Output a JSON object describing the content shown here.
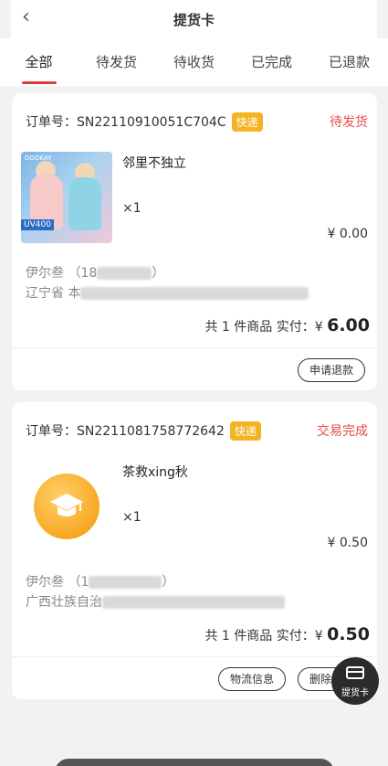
{
  "header": {
    "title": "提货卡",
    "back_icon": "‹"
  },
  "tabs": [
    {
      "label": "全部",
      "active": true
    },
    {
      "label": "待发货"
    },
    {
      "label": "待收货"
    },
    {
      "label": "已完成"
    },
    {
      "label": "已退款"
    }
  ],
  "orders": [
    {
      "order_no": "订单号：SN22110910051C704C",
      "badge": "快递",
      "status": "待发货",
      "product_name": "邻里不独立",
      "quantity": "×1",
      "price": "¥ 0.00",
      "recipient_name": "伊尔叁",
      "recipient_phone": "（18",
      "recipient_phone_end": "）",
      "address_start": "辽宁省 本",
      "total_prefix": "共 1 件商品 实付：¥",
      "total_amount": "6.00",
      "buttons": [
        "申请退款"
      ],
      "thumb_brand": "DOOKAY",
      "thumb_uv": "UV400"
    },
    {
      "order_no": "订单号：SN2211081758772642",
      "badge": "快递",
      "status": "交易完成",
      "product_name": "茶救xing秋",
      "quantity": "×1",
      "price": "¥ 0.50",
      "recipient_name": "伊尔叁",
      "recipient_phone": "（1",
      "recipient_phone_end": "）",
      "address_start": "广西壮族自治",
      "total_prefix": "共 1 件商品 实付：¥",
      "total_amount": "0.50",
      "buttons": [
        "物流信息",
        "删除订单"
      ]
    }
  ],
  "fab": {
    "label": "提货卡",
    "icon": "card-icon"
  },
  "colors": {
    "accent": "#e33b3b",
    "badge": "#f4b321",
    "status": "#e84a4a"
  }
}
